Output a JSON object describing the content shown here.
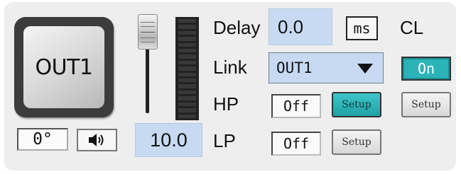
{
  "output": {
    "name": "OUT1"
  },
  "phase": {
    "value": "0°"
  },
  "mute": {
    "icon": "speaker-icon"
  },
  "fader": {
    "value": "10.0"
  },
  "meter": {
    "segments": 17
  },
  "delay": {
    "label": "Delay",
    "value": "0.0",
    "unit_button": "ms"
  },
  "cl": {
    "label": "CL",
    "state": "On"
  },
  "link": {
    "label": "Link",
    "value": "OUT1"
  },
  "hp": {
    "label": "HP",
    "state": "Off",
    "setup_label": "Setup"
  },
  "lp": {
    "label": "LP",
    "state": "Off",
    "setup_label": "Setup"
  },
  "cl_setup": {
    "label": "Setup"
  },
  "colors": {
    "accent": "#2bb4b8",
    "field": "#c7daf2",
    "panel": "#eeeeee"
  }
}
